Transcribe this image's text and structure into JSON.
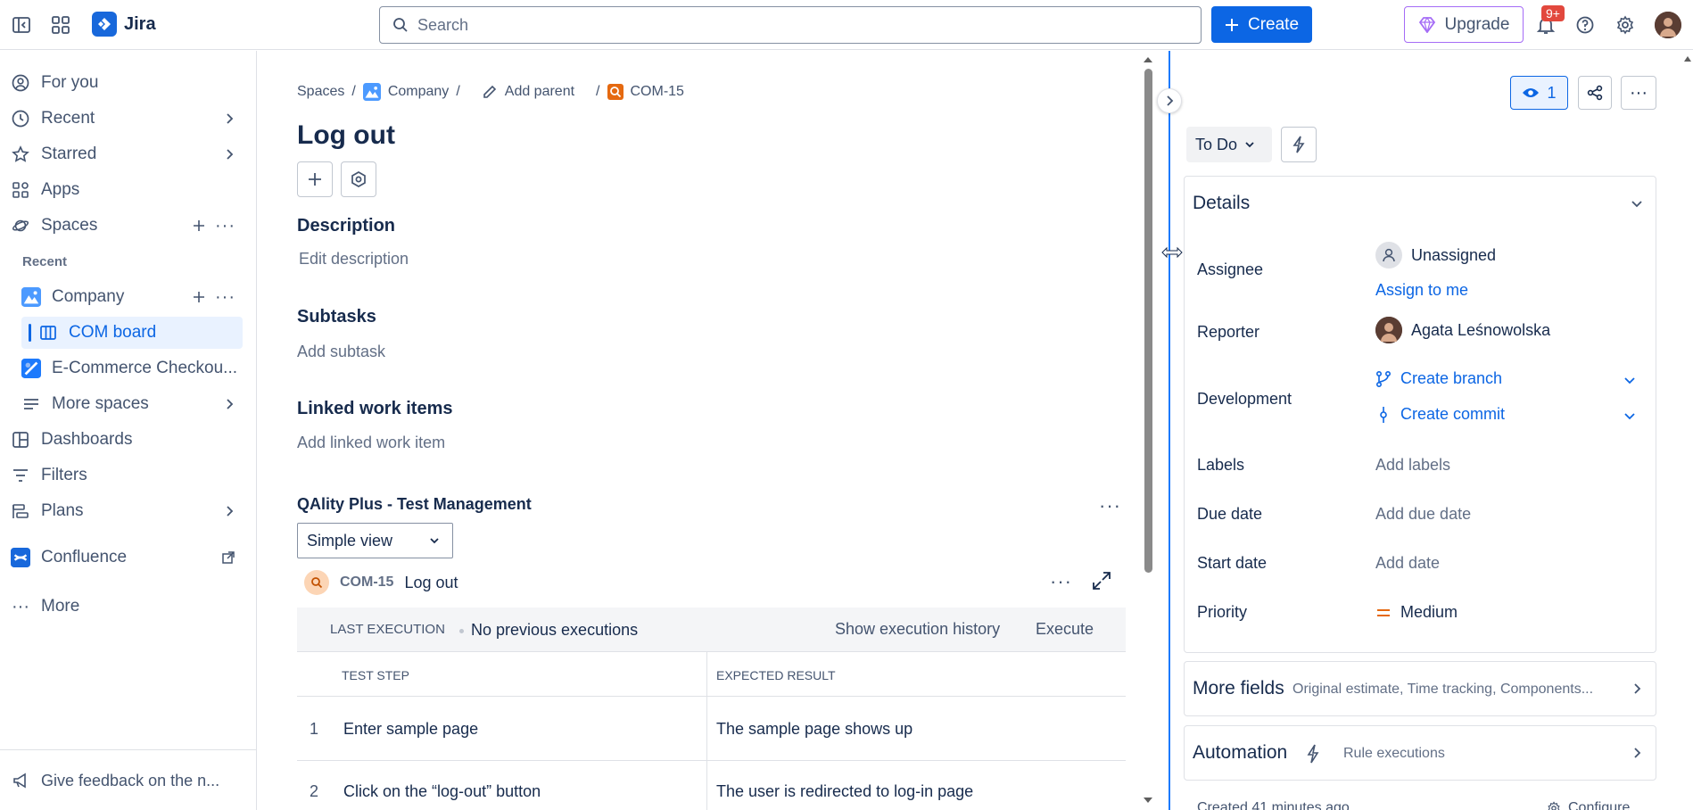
{
  "topbar": {
    "app_name": "Jira",
    "search_placeholder": "Search",
    "create_label": "Create",
    "upgrade_label": "Upgrade",
    "notif_badge": "9+"
  },
  "sidebar": {
    "for_you": "For you",
    "recent": "Recent",
    "starred": "Starred",
    "apps": "Apps",
    "spaces": "Spaces",
    "recent_section": "Recent",
    "company": "Company",
    "com_board": "COM board",
    "ecommerce": "E-Commerce Checkou...",
    "more_spaces": "More spaces",
    "dashboards": "Dashboards",
    "filters": "Filters",
    "plans": "Plans",
    "confluence": "Confluence",
    "more": "More",
    "feedback": "Give feedback on the n..."
  },
  "breadcrumb": {
    "spaces": "Spaces",
    "company": "Company",
    "add_parent": "Add parent",
    "issue_key": "COM-15"
  },
  "issue": {
    "title": "Log out",
    "description_heading": "Description",
    "description_placeholder": "Edit description",
    "subtasks_heading": "Subtasks",
    "subtasks_placeholder": "Add subtask",
    "linked_heading": "Linked work items",
    "linked_placeholder": "Add linked work item"
  },
  "qality": {
    "heading": "QAlity Plus - Test Management",
    "view_select": "Simple view",
    "issue_key": "COM-15",
    "issue_title": "Log out",
    "last_execution_label": "LAST EXECUTION",
    "last_execution_value": "No previous executions",
    "show_history": "Show execution history",
    "execute": "Execute",
    "col_step": "TEST STEP",
    "col_expected": "EXPECTED RESULT",
    "rows": [
      {
        "num": "1",
        "step": "Enter sample page",
        "expected": "The sample page shows up"
      },
      {
        "num": "2",
        "step": "Click on the “log-out” button",
        "expected": "The user is redirected to log-in page"
      }
    ]
  },
  "panel": {
    "watch_count": "1",
    "status": "To Do",
    "details_heading": "Details",
    "assignee_label": "Assignee",
    "assignee_value": "Unassigned",
    "assign_to_me": "Assign to me",
    "reporter_label": "Reporter",
    "reporter_value": "Agata Leśnowolska",
    "development_label": "Development",
    "create_branch": "Create branch",
    "create_commit": "Create commit",
    "labels_label": "Labels",
    "labels_value": "Add labels",
    "due_label": "Due date",
    "due_value": "Add due date",
    "start_label": "Start date",
    "start_value": "Add date",
    "priority_label": "Priority",
    "priority_value": "Medium",
    "more_fields": "More fields",
    "more_fields_sub": "Original estimate, Time tracking, Components...",
    "automation": "Automation",
    "automation_sub": "Rule executions",
    "created_text": "Created 41 minutes ago",
    "configure": "Configure"
  }
}
